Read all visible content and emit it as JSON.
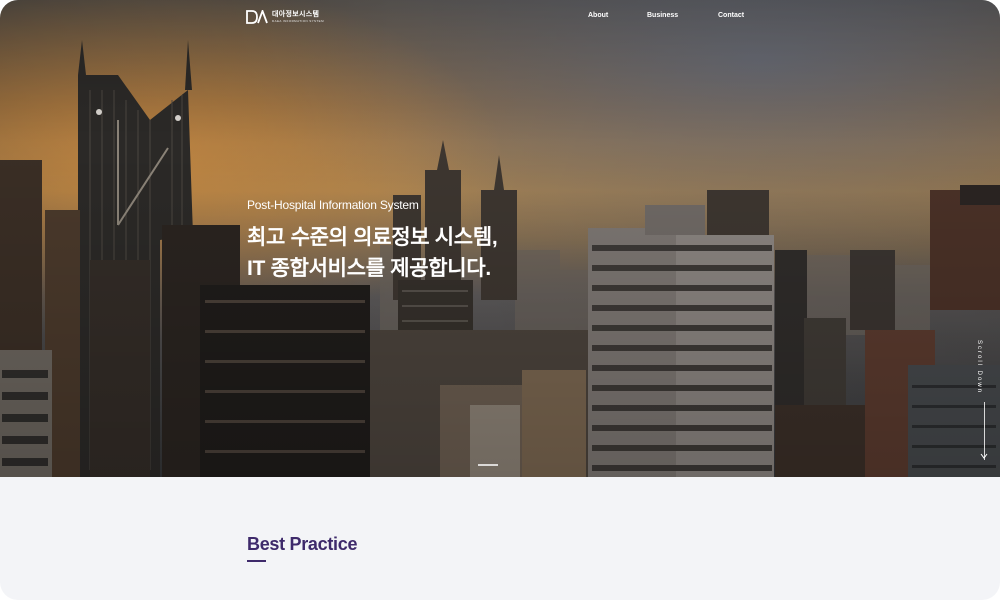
{
  "brand": {
    "logo_mark": "DA",
    "name": "대아정보시스템",
    "tagline": "DAEA INFORMATION SYSTEM"
  },
  "nav": {
    "items": [
      {
        "label": "About"
      },
      {
        "label": "Business"
      },
      {
        "label": "Contact"
      }
    ]
  },
  "hero": {
    "eyebrow": "Post-Hospital Information System",
    "headline_line1": "최고 수준의 의료정보 시스템,",
    "headline_line2": "IT 종합서비스를 제공합니다.",
    "scroll_label": "Scroll Down"
  },
  "section": {
    "title": "Best Practice"
  },
  "colors": {
    "accent": "#3e2a6b",
    "lower_background": "#f3f4f7"
  }
}
